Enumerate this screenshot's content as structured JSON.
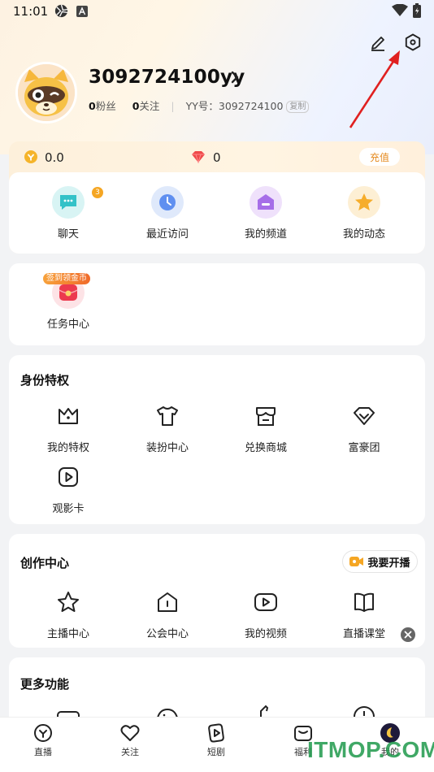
{
  "status_bar": {
    "time": "11:01"
  },
  "header": {
    "edit_icon": "pencil-icon",
    "settings_icon": "hexagon-settings-icon"
  },
  "profile": {
    "username": "3092724100yy",
    "fans_count": "0",
    "fans_label": "粉丝",
    "follow_count": "0",
    "follow_label": "关注",
    "yy_label": "YY号：",
    "yy_number": "3092724100",
    "copy_label": "复制"
  },
  "wallet": {
    "coin_value": "0.0",
    "diamond_value": "0",
    "recharge_label": "充值"
  },
  "quick_actions": [
    {
      "label": "聊天",
      "icon": "chat-icon",
      "badge": "3"
    },
    {
      "label": "最近访问",
      "icon": "clock-icon"
    },
    {
      "label": "我的频道",
      "icon": "channel-icon"
    },
    {
      "label": "我的动态",
      "icon": "star-icon"
    }
  ],
  "tasks": {
    "tag": "签到领金币",
    "label": "任务中心"
  },
  "identity": {
    "title": "身份特权",
    "items": [
      {
        "label": "我的特权",
        "icon": "crown-icon"
      },
      {
        "label": "装扮中心",
        "icon": "tshirt-icon"
      },
      {
        "label": "兑换商城",
        "icon": "store-icon"
      },
      {
        "label": "富豪团",
        "icon": "diamond-icon"
      },
      {
        "label": "观影卡",
        "icon": "movie-card-icon"
      }
    ]
  },
  "creation": {
    "title": "创作中心",
    "live_button": "我要开播",
    "items": [
      {
        "label": "主播中心",
        "icon": "star-outline-icon"
      },
      {
        "label": "公会中心",
        "icon": "guild-icon"
      },
      {
        "label": "我的视频",
        "icon": "video-icon"
      },
      {
        "label": "直播课堂",
        "icon": "book-icon"
      }
    ]
  },
  "more": {
    "title": "更多功能"
  },
  "bottom_nav": [
    {
      "label": "直播",
      "icon": "live-icon"
    },
    {
      "label": "关注",
      "icon": "heart-icon"
    },
    {
      "label": "短剧",
      "icon": "play-icon"
    },
    {
      "label": "福利",
      "icon": "gift-box-icon"
    },
    {
      "label": "我的",
      "icon": "profile-avatar-icon"
    }
  ],
  "watermark": "ITMOP.COM",
  "colors": {
    "accent_orange": "#f5a623",
    "arrow_red": "#e02020",
    "watermark_green": "#1f9a4c"
  }
}
